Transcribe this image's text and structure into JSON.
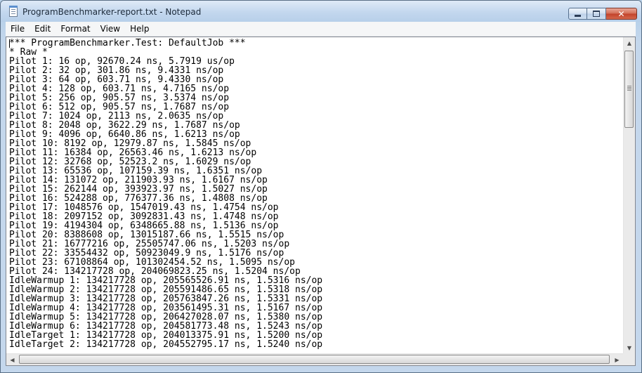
{
  "window": {
    "title": "ProgramBenchmarker-report.txt - Notepad",
    "icon": "notepad-icon",
    "caption_buttons": {
      "minimize": "minimize-icon",
      "maximize": "maximize-icon",
      "close": "✕"
    }
  },
  "menu": {
    "items": [
      {
        "label": "File"
      },
      {
        "label": "Edit"
      },
      {
        "label": "Format"
      },
      {
        "label": "View"
      },
      {
        "label": "Help"
      }
    ]
  },
  "document": {
    "lines": [
      "*** ProgramBenchmarker.Test: DefaultJob ***",
      "* Raw *",
      "Pilot 1: 16 op, 92670.24 ns, 5.7919 us/op",
      "Pilot 2: 32 op, 301.86 ns, 9.4331 ns/op",
      "Pilot 3: 64 op, 603.71 ns, 9.4330 ns/op",
      "Pilot 4: 128 op, 603.71 ns, 4.7165 ns/op",
      "Pilot 5: 256 op, 905.57 ns, 3.5374 ns/op",
      "Pilot 6: 512 op, 905.57 ns, 1.7687 ns/op",
      "Pilot 7: 1024 op, 2113 ns, 2.0635 ns/op",
      "Pilot 8: 2048 op, 3622.29 ns, 1.7687 ns/op",
      "Pilot 9: 4096 op, 6640.86 ns, 1.6213 ns/op",
      "Pilot 10: 8192 op, 12979.87 ns, 1.5845 ns/op",
      "Pilot 11: 16384 op, 26563.46 ns, 1.6213 ns/op",
      "Pilot 12: 32768 op, 52523.2 ns, 1.6029 ns/op",
      "Pilot 13: 65536 op, 107159.39 ns, 1.6351 ns/op",
      "Pilot 14: 131072 op, 211903.93 ns, 1.6167 ns/op",
      "Pilot 15: 262144 op, 393923.97 ns, 1.5027 ns/op",
      "Pilot 16: 524288 op, 776377.36 ns, 1.4808 ns/op",
      "Pilot 17: 1048576 op, 1547019.43 ns, 1.4754 ns/op",
      "Pilot 18: 2097152 op, 3092831.43 ns, 1.4748 ns/op",
      "Pilot 19: 4194304 op, 6348665.88 ns, 1.5136 ns/op",
      "Pilot 20: 8388608 op, 13015187.66 ns, 1.5515 ns/op",
      "Pilot 21: 16777216 op, 25505747.06 ns, 1.5203 ns/op",
      "Pilot 22: 33554432 op, 50923049.9 ns, 1.5176 ns/op",
      "Pilot 23: 67108864 op, 101302454.52 ns, 1.5095 ns/op",
      "Pilot 24: 134217728 op, 204069823.25 ns, 1.5204 ns/op",
      "IdleWarmup 1: 134217728 op, 205565526.91 ns, 1.5316 ns/op",
      "IdleWarmup 2: 134217728 op, 205591486.65 ns, 1.5318 ns/op",
      "IdleWarmup 3: 134217728 op, 205763847.26 ns, 1.5331 ns/op",
      "IdleWarmup 4: 134217728 op, 203561495.31 ns, 1.5167 ns/op",
      "IdleWarmup 5: 134217728 op, 206427028.07 ns, 1.5380 ns/op",
      "IdleWarmup 6: 134217728 op, 204581773.48 ns, 1.5243 ns/op",
      "IdleTarget 1: 134217728 op, 204013375.91 ns, 1.5200 ns/op",
      "IdleTarget 2: 134217728 op, 204552795.17 ns, 1.5240 ns/op"
    ]
  },
  "scrollbars": {
    "up_arrow": "▲",
    "down_arrow": "▼",
    "left_arrow": "◀",
    "right_arrow": "▶"
  }
}
